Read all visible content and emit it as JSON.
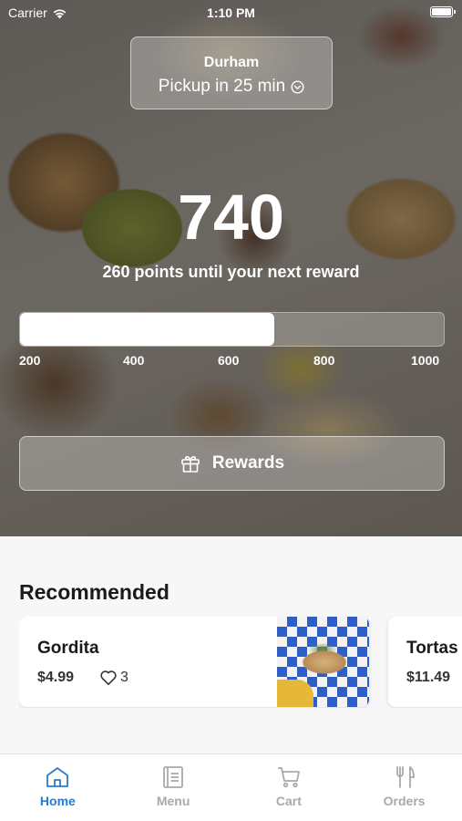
{
  "status_bar": {
    "carrier": "Carrier",
    "time": "1:10 PM"
  },
  "location": {
    "city": "Durham",
    "pickup": "Pickup in 25 min"
  },
  "rewards": {
    "points": "740",
    "subtitle": "260 points until your next reward",
    "progress_fraction": 0.6,
    "ticks": [
      "200",
      "400",
      "600",
      "800",
      "1000"
    ],
    "button_label": "Rewards"
  },
  "recommended": {
    "title": "Recommended",
    "items": [
      {
        "name": "Gordita",
        "price": "$4.99",
        "likes": "3"
      },
      {
        "name": "Tortas",
        "price": "$11.49"
      }
    ]
  },
  "tabs": [
    {
      "label": "Home",
      "icon": "home-icon",
      "active": true
    },
    {
      "label": "Menu",
      "icon": "menu-icon",
      "active": false
    },
    {
      "label": "Cart",
      "icon": "cart-icon",
      "active": false
    },
    {
      "label": "Orders",
      "icon": "utensils-icon",
      "active": false
    }
  ],
  "colors": {
    "accent": "#2a7bd0",
    "inactive_tab": "#a9a9a9"
  }
}
